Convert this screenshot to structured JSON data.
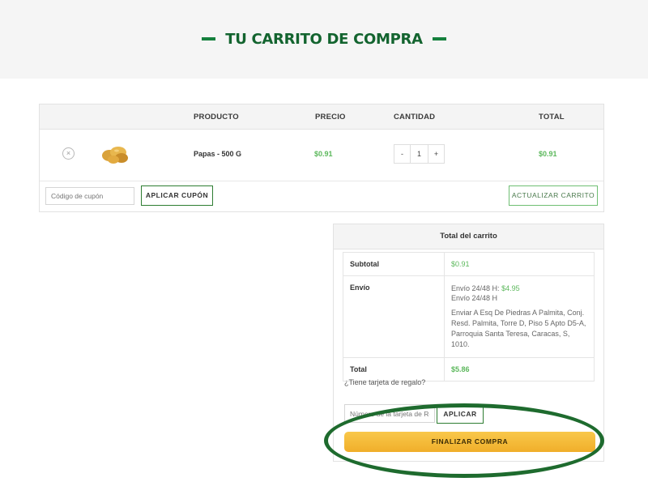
{
  "header": {
    "title": "TU CARRITO DE COMPRA"
  },
  "cart": {
    "columns": {
      "product": "PRODUCTO",
      "price": "PRECIO",
      "quantity": "CANTIDAD",
      "total": "TOTAL"
    },
    "items": [
      {
        "remove": "×",
        "name": "Papas - 500 G",
        "price": "$0.91",
        "qty_minus": "-",
        "qty": "1",
        "qty_plus": "+",
        "total": "$0.91"
      }
    ],
    "coupon_placeholder": "Código de cupón",
    "apply_coupon": "APLICAR CUPÓN",
    "update_cart": "ACTUALIZAR CARRITO"
  },
  "totals": {
    "title": "Total del carrito",
    "subtotal_label": "Subtotal",
    "subtotal_value": "$0.91",
    "shipping_label": "Envío",
    "shipping_option_prefix": "Envío 24/48 H:",
    "shipping_option_price": "$4.95",
    "shipping_method": "Envío 24/48 H",
    "shipping_address": "Enviar A Esq De Piedras A Palmita, Conj. Resd. Palmita, Torre D, Piso 5 Apto D5-A, Parroquia Santa Teresa, Caracas, S, 1010.",
    "total_label": "Total",
    "total_value": "$5.86",
    "gift_question": "¿Tiene tarjeta de regalo?",
    "gift_placeholder": "Número de la tarjeta de Regalo",
    "gift_apply": "APLICAR",
    "checkout": "FINALIZAR COMPRA"
  },
  "colors": {
    "brand_green": "#13642f",
    "price_green": "#5cb85c",
    "checkout_yellow": "#f5b93a",
    "annotation_green": "#1e6b2e"
  }
}
